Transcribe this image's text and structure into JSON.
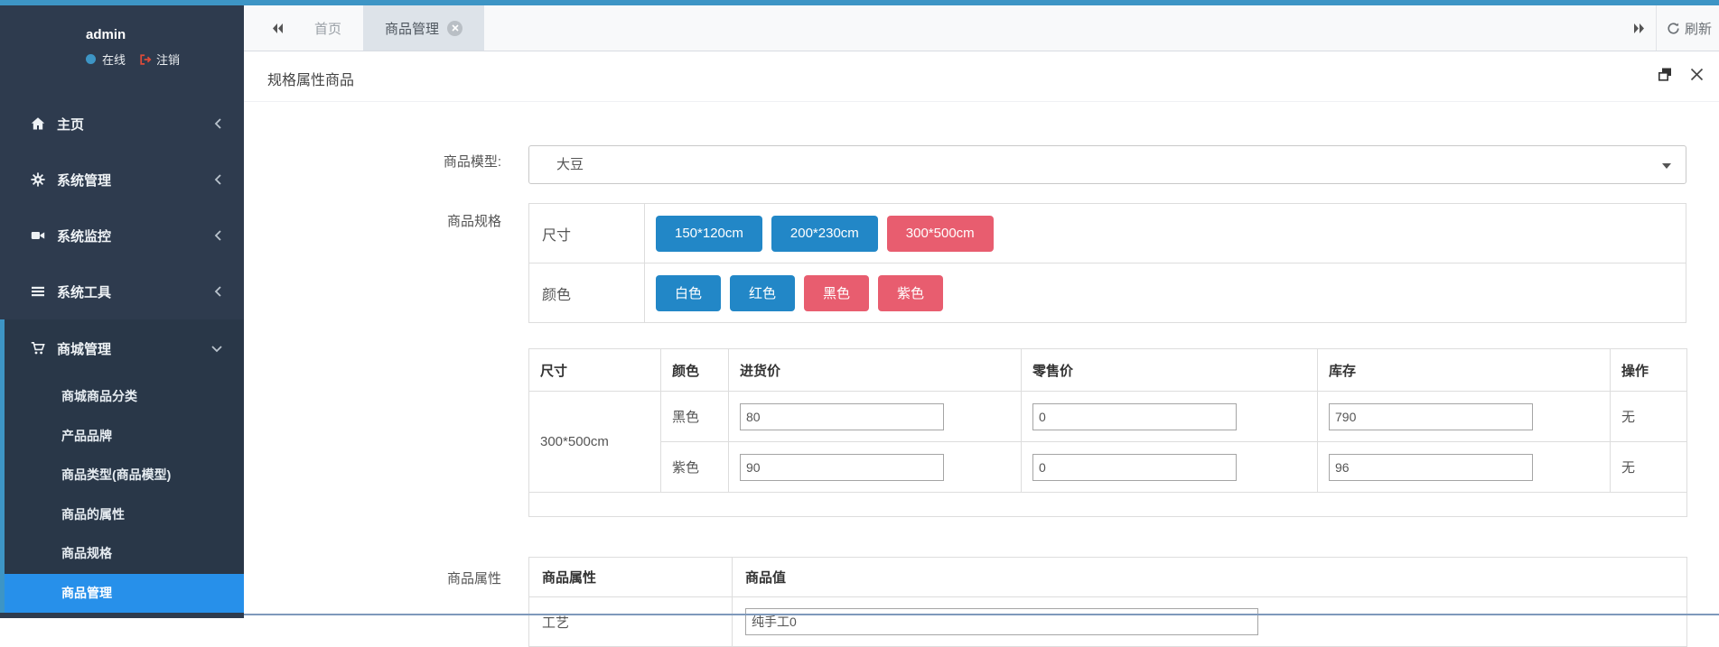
{
  "colors": {
    "accent_blue": "#3d95c5",
    "sidebar_bg": "#2e3b4e",
    "active_menu_blue": "#2790ea",
    "button_blue": "#2287c7",
    "button_red": "#e85d6f",
    "logout_red": "#dd4b39"
  },
  "sidebar": {
    "user": {
      "name": "admin",
      "status_label": "在线",
      "logout_label": "注销"
    },
    "menu": [
      {
        "label": "主页"
      },
      {
        "label": "系统管理"
      },
      {
        "label": "系统监控"
      },
      {
        "label": "系统工具"
      },
      {
        "label": "商城管理"
      }
    ],
    "submenu": [
      "商城商品分类",
      "产品品牌",
      "商品类型(商品模型)",
      "商品的属性",
      "商品规格",
      "商品管理"
    ]
  },
  "tabbar": {
    "tabs": [
      {
        "label": "首页"
      },
      {
        "label": "商品管理"
      }
    ],
    "refresh_label": "刷新"
  },
  "panel": {
    "title": "规格属性商品"
  },
  "form": {
    "model": {
      "label": "商品模型:",
      "value": "大豆"
    },
    "spec": {
      "label": "商品规格",
      "rows": [
        {
          "name": "尺寸",
          "options": [
            {
              "label": "150*120cm",
              "variant": "blue"
            },
            {
              "label": "200*230cm",
              "variant": "blue"
            },
            {
              "label": "300*500cm",
              "variant": "red"
            }
          ]
        },
        {
          "name": "颜色",
          "options": [
            {
              "label": "白色",
              "variant": "blue"
            },
            {
              "label": "红色",
              "variant": "blue"
            },
            {
              "label": "黑色",
              "variant": "red"
            },
            {
              "label": "紫色",
              "variant": "red"
            }
          ]
        }
      ]
    },
    "sku_table": {
      "headers": [
        "尺寸",
        "颜色",
        "进货价",
        "零售价",
        "库存",
        "操作"
      ],
      "size_group": "300*500cm",
      "rows": [
        {
          "color": "黑色",
          "purchase": "80",
          "retail": "0",
          "stock": "790",
          "action": "无"
        },
        {
          "color": "紫色",
          "purchase": "90",
          "retail": "0",
          "stock": "96",
          "action": "无"
        }
      ]
    },
    "attrs": {
      "label": "商品属性",
      "headers": [
        "商品属性",
        "商品值"
      ],
      "rows": [
        {
          "name": "工艺",
          "value": "纯手工0"
        }
      ]
    }
  }
}
